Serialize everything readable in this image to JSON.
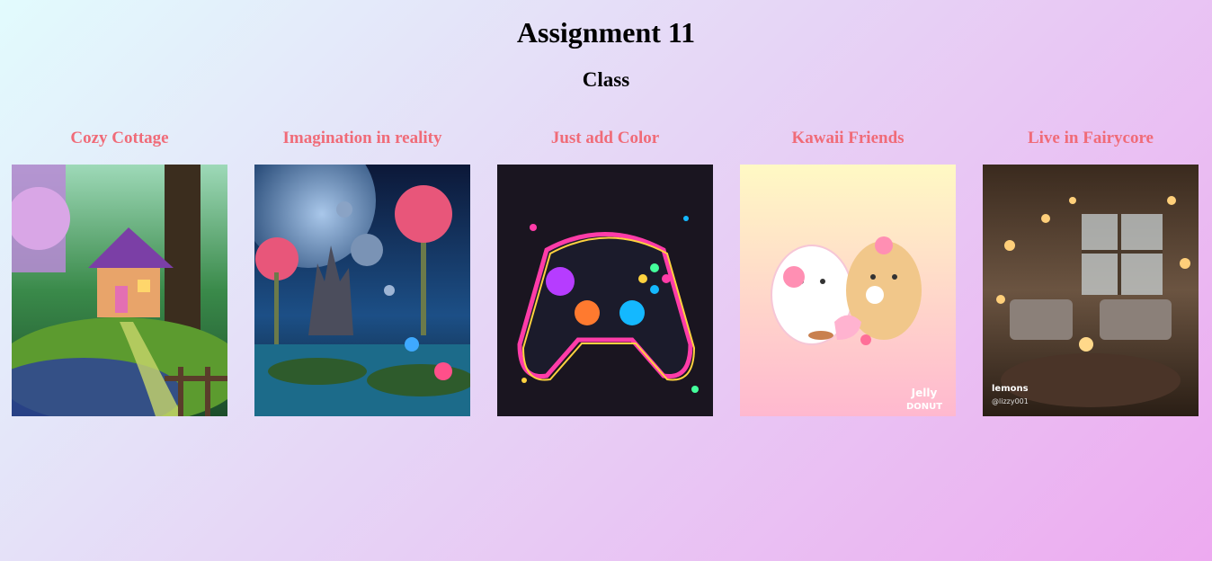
{
  "page": {
    "title": "Assignment 11",
    "subtitle": "Class"
  },
  "cards": [
    {
      "title": "Cozy Cottage",
      "icon": "cottage-image"
    },
    {
      "title": "Imagination in reality",
      "icon": "fantasy-island-image"
    },
    {
      "title": "Just add Color",
      "icon": "game-controller-image"
    },
    {
      "title": "Kawaii Friends",
      "icon": "kawaii-friends-image",
      "watermark_lines": [
        "Jelly",
        "DONUT"
      ]
    },
    {
      "title": "Live in Fairycore",
      "icon": "fairycore-room-image",
      "watermark_lines": [
        "lemons",
        "@lizzy001"
      ]
    }
  ],
  "colors": {
    "card_title": "#f06b78",
    "bg_start": "#e2fbfd",
    "bg_end": "#edaaf0"
  }
}
